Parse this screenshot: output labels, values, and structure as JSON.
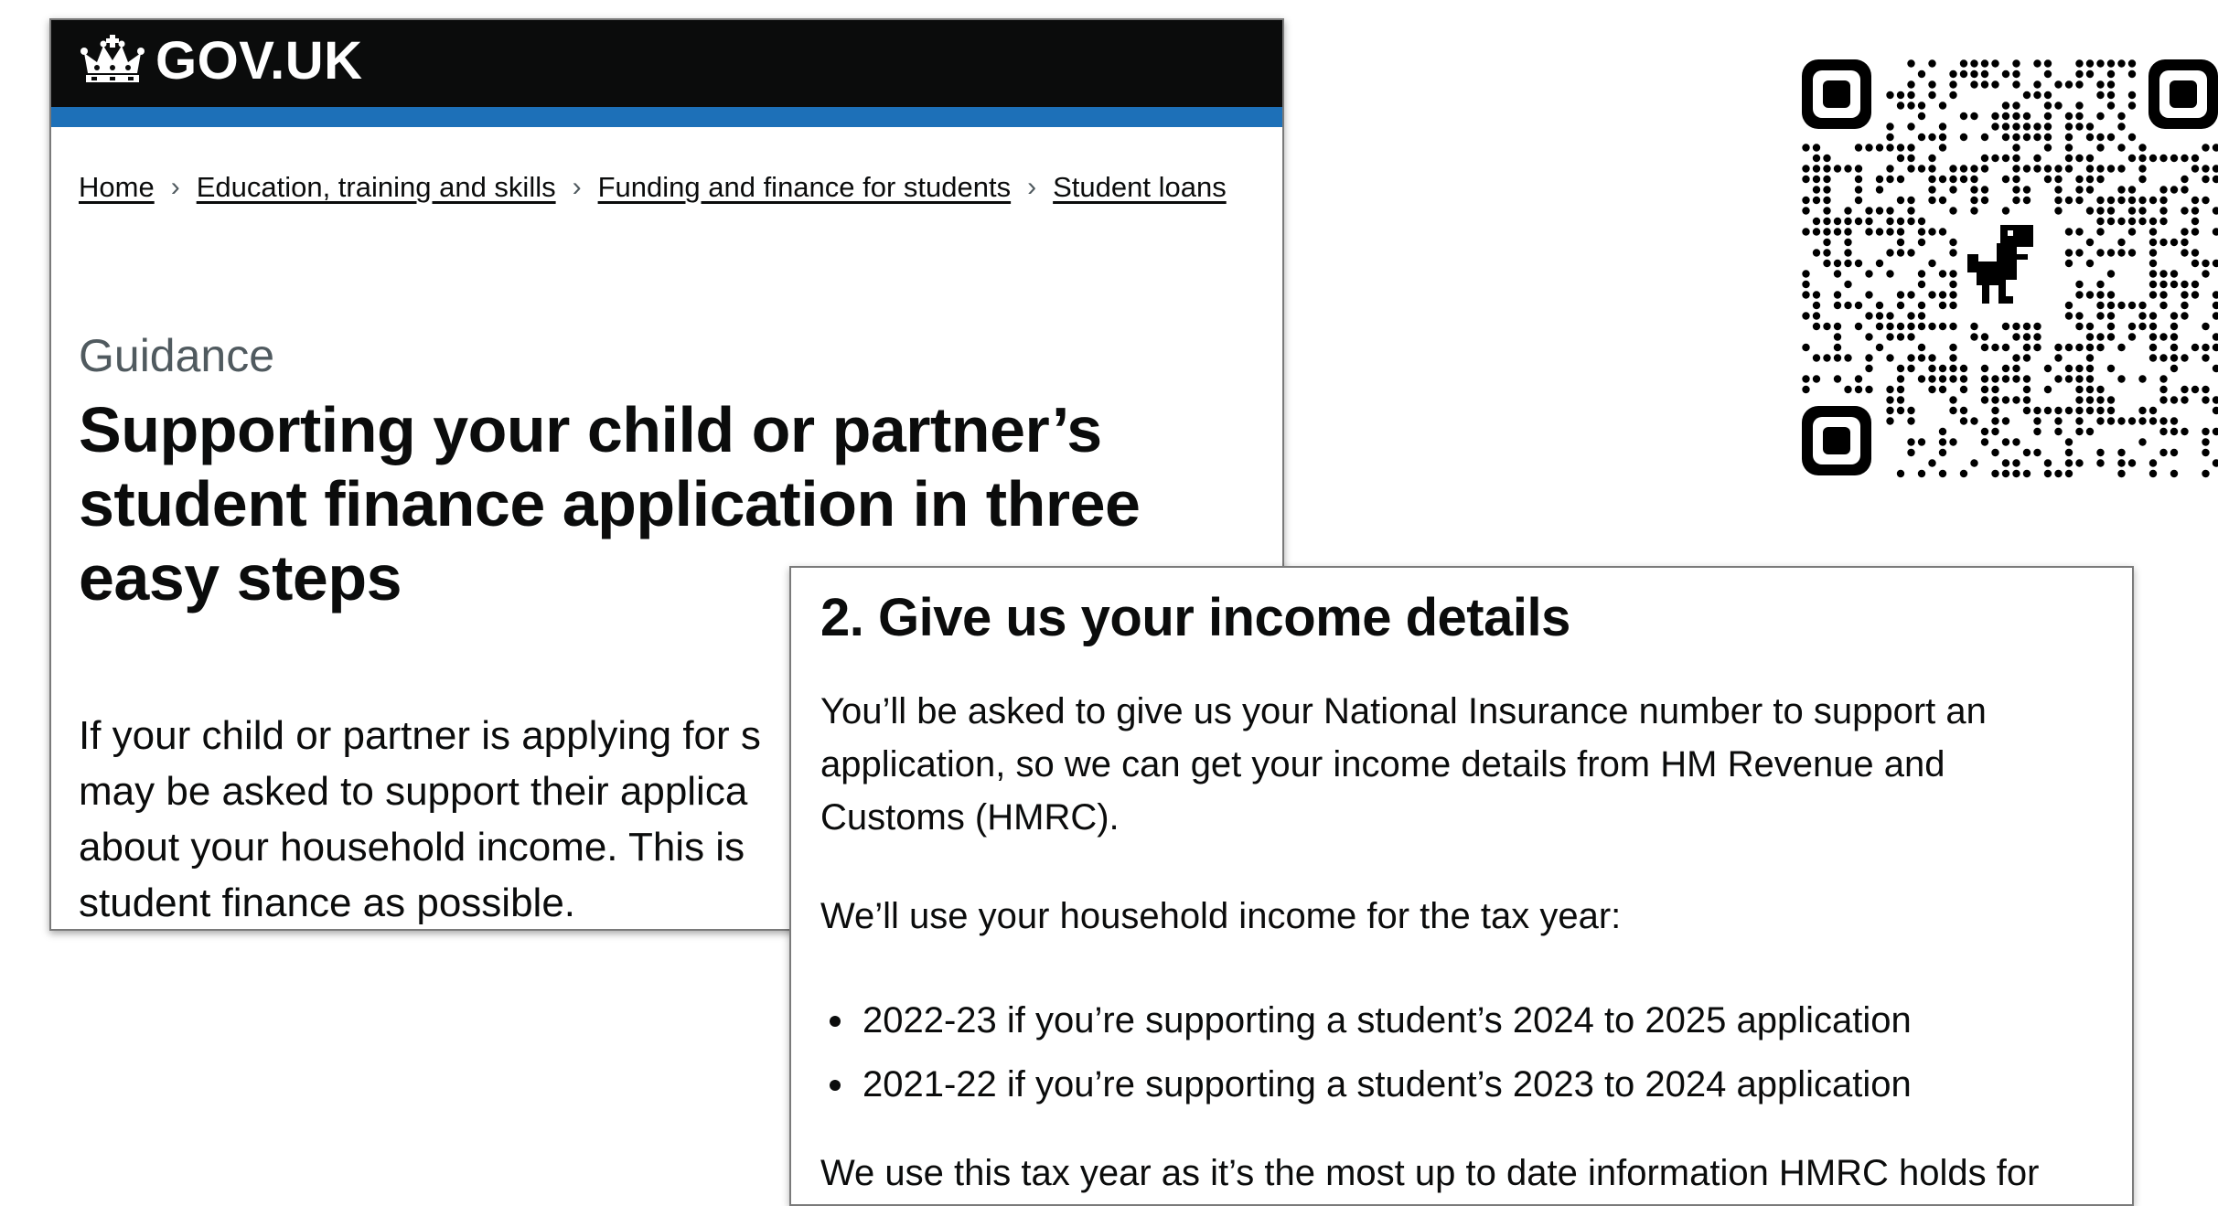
{
  "header": {
    "logo_text": "GOV.UK",
    "logo_icon": "crown-icon",
    "bar_color": "#0b0c0c",
    "accent_color": "#1d70b8"
  },
  "breadcrumb": {
    "items": [
      "Home",
      "Education, training and skills",
      "Funding and finance for students",
      "Student loans"
    ],
    "separator_icon": "chevron-right-icon"
  },
  "page": {
    "caption": "Guidance",
    "title": "Supporting your child or partner’s student finance application in three easy steps",
    "lead_lines": [
      "If your child or partner is applying for s",
      "may be asked to support their applica",
      "about your household income. This is",
      "student finance as possible."
    ]
  },
  "income_section": {
    "heading": "2. Give us your income details",
    "para1_lines": [
      "You’ll be asked to give us your National Insurance number to support an",
      "application, so we can get your income details from HM Revenue and",
      "Customs (HMRC)."
    ],
    "para2": "We’ll use your household income for the tax year:",
    "bullets": [
      "2022-23 if you’re supporting a student’s 2024 to 2025 application",
      "2021-22 if you’re supporting a student’s 2023 to 2024 application"
    ],
    "para3": "We use this tax year as it’s the most up to date information HMRC holds for"
  },
  "qr_code": {
    "icon": "qr-code-icon",
    "center_icon": "dinosaur-icon"
  }
}
